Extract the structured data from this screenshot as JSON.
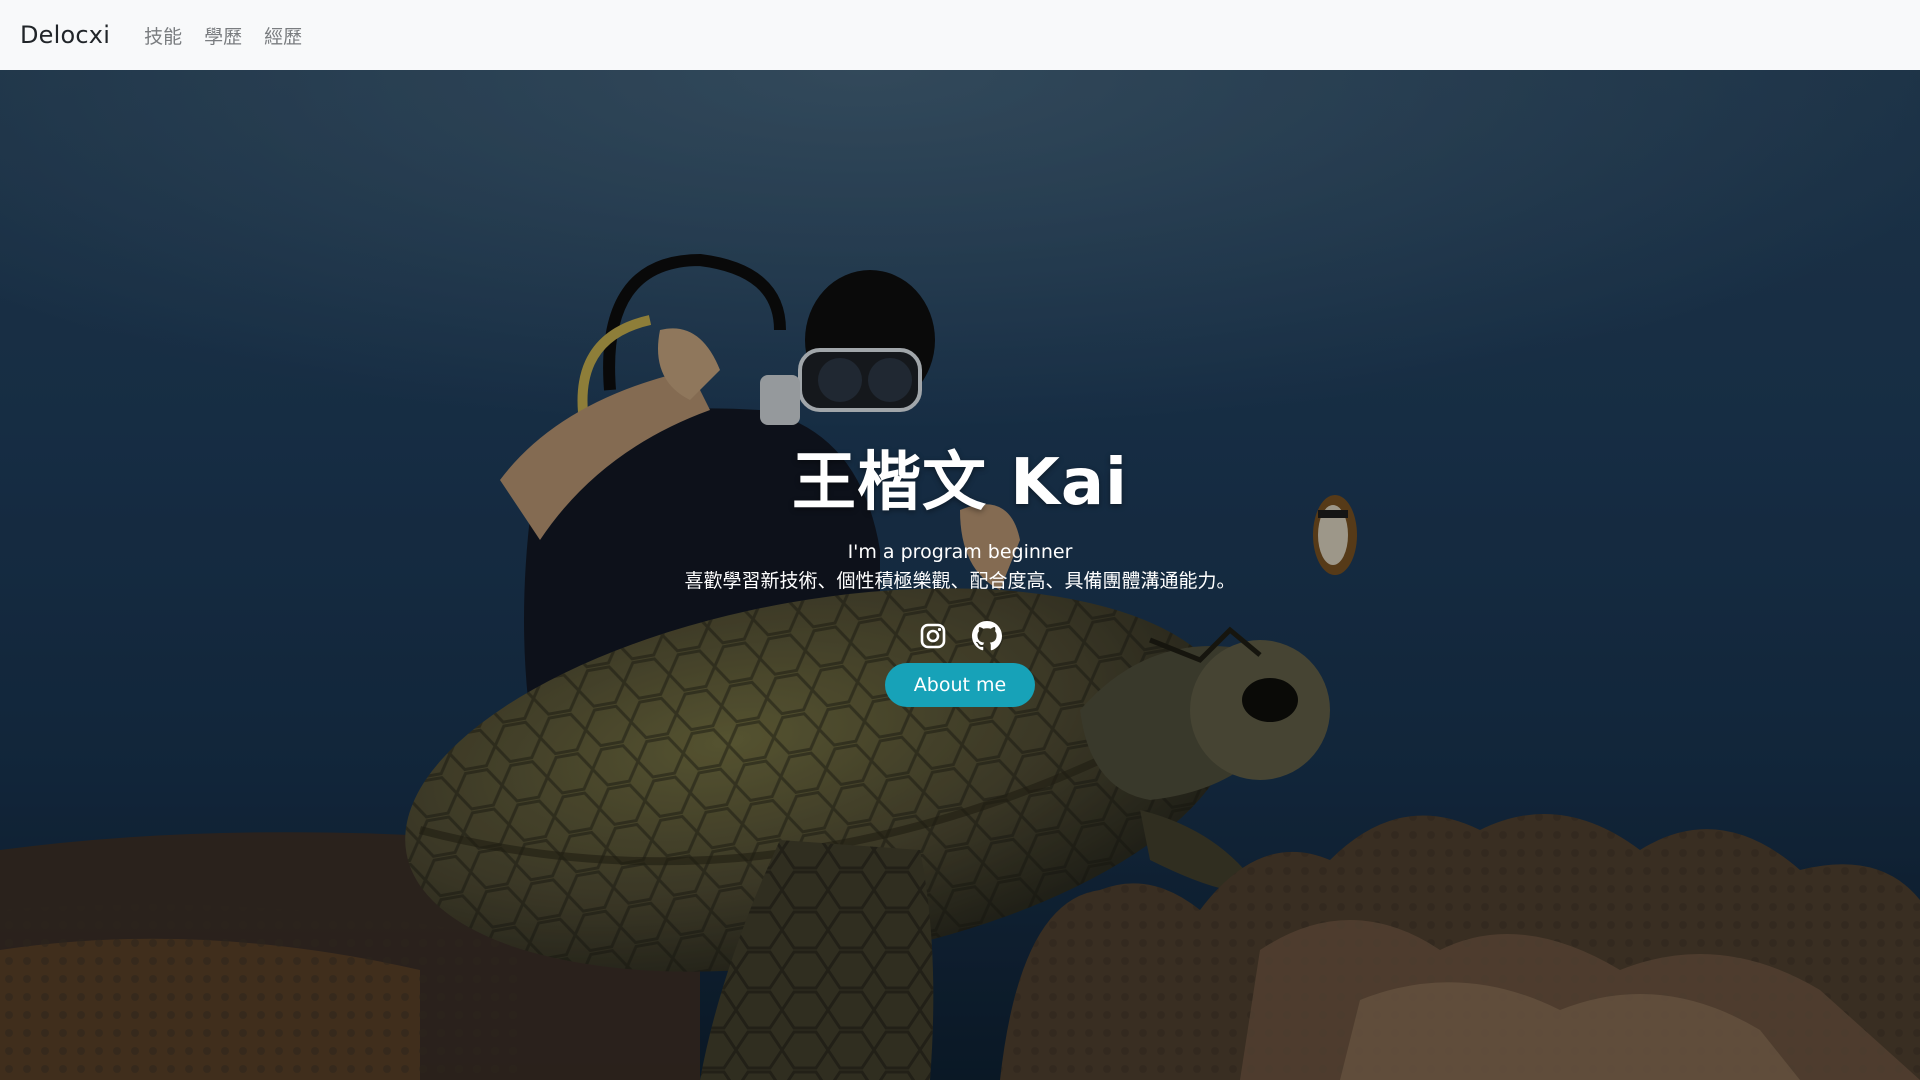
{
  "nav": {
    "brand": "Delocxi",
    "links": [
      "技能",
      "學歷",
      "經歷"
    ]
  },
  "hero": {
    "title": "王楷文 Kai",
    "subtitle": "I'm a program beginner",
    "description": "喜歡學習新技術、個性積極樂觀、配合度高、具備團體溝通能力。",
    "social_icons": [
      "instagram-icon",
      "github-icon"
    ],
    "button_label": "About me"
  },
  "colors": {
    "navbar_bg": "#f8f9fa",
    "brand_text": "#212529",
    "nav_link": "#7a7d80",
    "button_bg": "#17a2b8",
    "hero_text": "#ffffff",
    "ocean_dark": "#0b1d2b",
    "ocean_mid": "#1f3f5e"
  }
}
